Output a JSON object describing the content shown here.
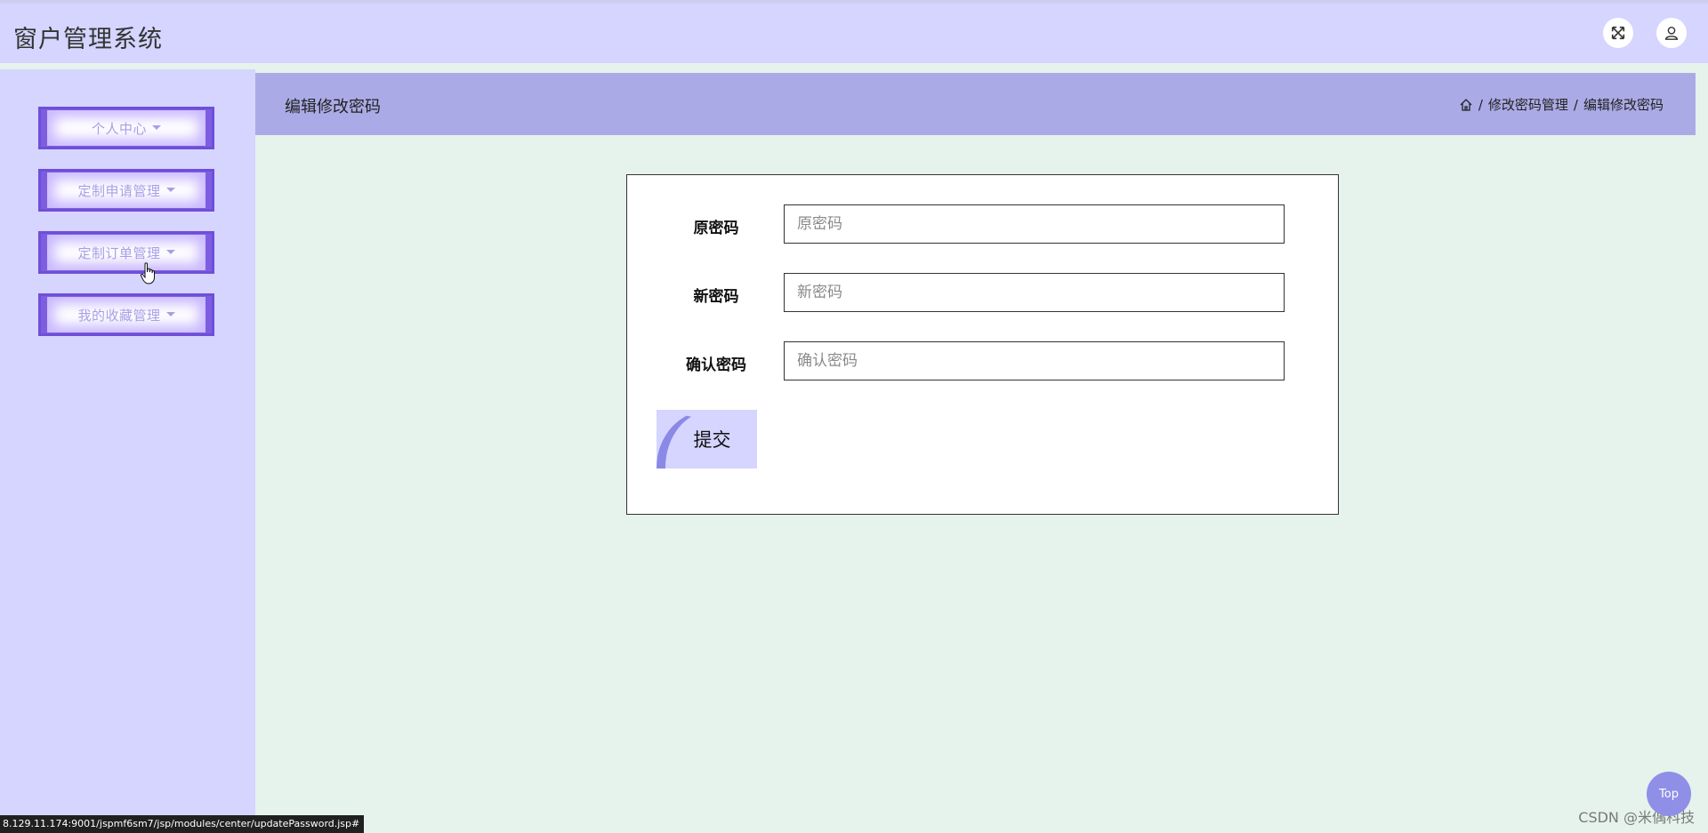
{
  "app": {
    "title": "窗户管理系统"
  },
  "header": {
    "expand_icon": "fullscreen-icon",
    "user_icon": "user-icon"
  },
  "sidebar": {
    "items": [
      {
        "label": "个人中心"
      },
      {
        "label": "定制申请管理"
      },
      {
        "label": "定制订单管理"
      },
      {
        "label": "我的收藏管理"
      }
    ]
  },
  "page": {
    "title": "编辑修改密码",
    "breadcrumb": [
      "修改密码管理",
      "编辑修改密码"
    ],
    "breadcrumb_sep": "/"
  },
  "form": {
    "fields": [
      {
        "label": "原密码",
        "placeholder": "原密码",
        "value": ""
      },
      {
        "label": "新密码",
        "placeholder": "新密码",
        "value": ""
      },
      {
        "label": "确认密码",
        "placeholder": "确认密码",
        "value": ""
      }
    ],
    "submit_label": "提交"
  },
  "status_bar": {
    "url": "8.129.11.174:9001/jspmf6sm7/jsp/modules/center/updatePassword.jsp#"
  },
  "watermark": "CSDN @米偶科技",
  "top_button": "Top",
  "colors": {
    "header_bg": "#d5d5ff",
    "title_bar_bg": "#aaabe6",
    "content_bg": "#e6f2ec",
    "menu_accent": "#7e5ee0"
  }
}
